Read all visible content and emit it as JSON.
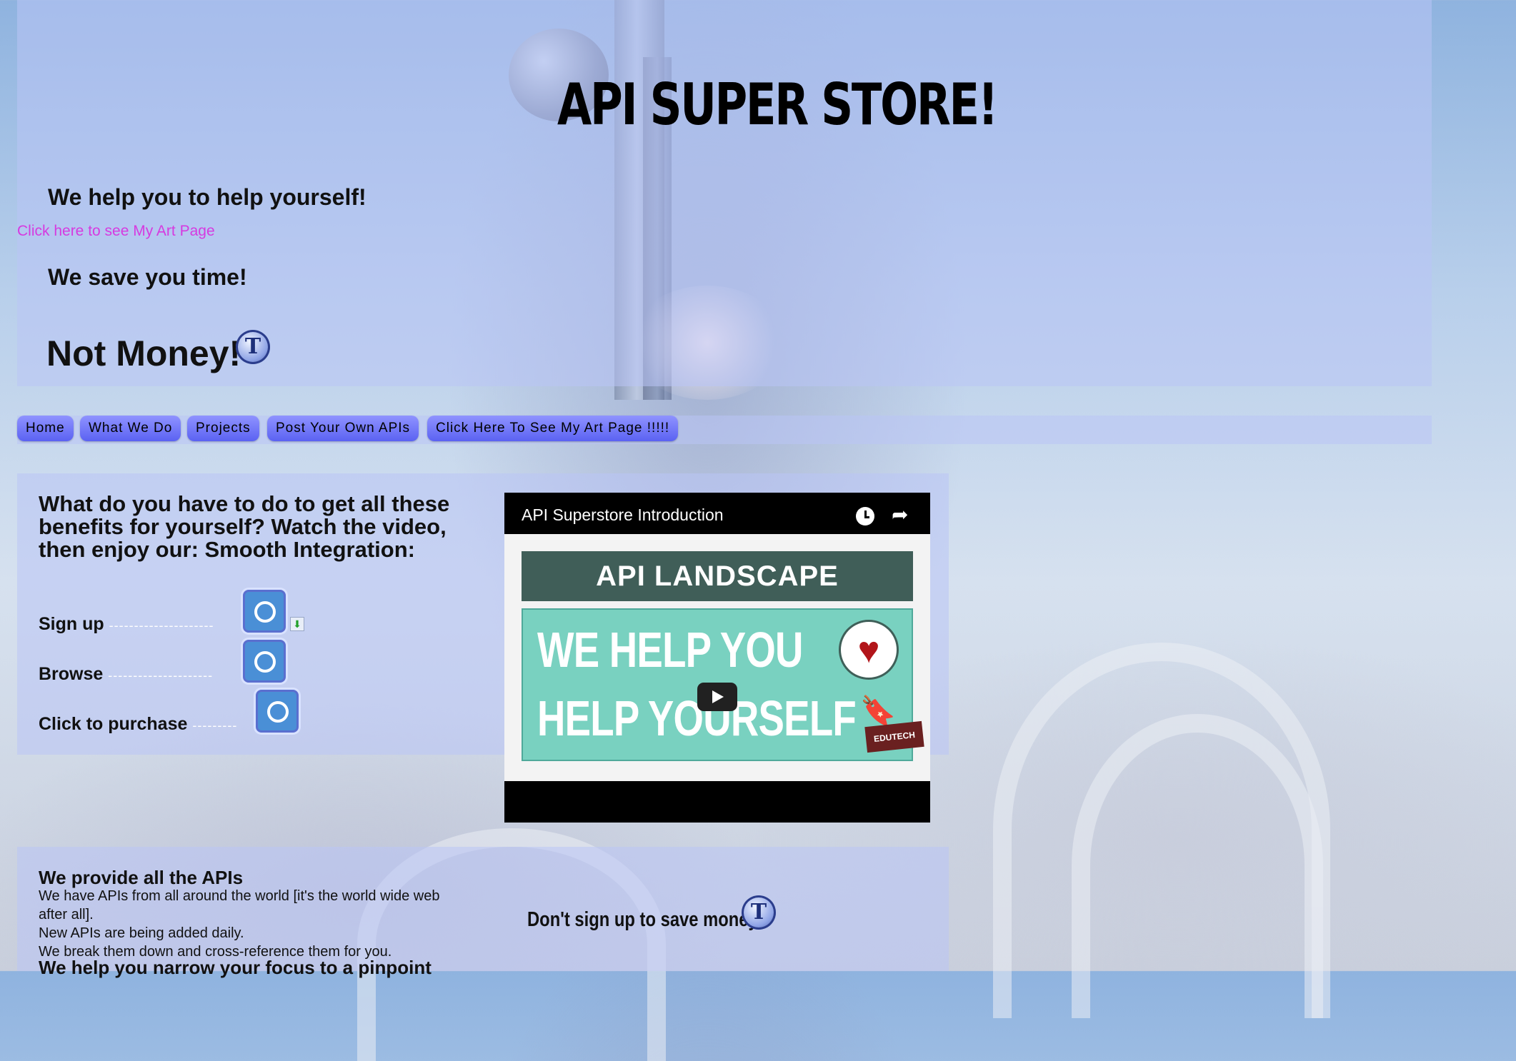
{
  "header": {
    "title": "API SUPER STORE!",
    "tagline_1": "We help you to help yourself!",
    "art_link": "Click here to see My Art Page",
    "tagline_2": "We save you time!",
    "tagline_3": "Not Money!",
    "logo_letter": "T"
  },
  "nav": {
    "items": [
      {
        "label": "Home"
      },
      {
        "label": "What We Do"
      },
      {
        "label": "Projects"
      },
      {
        "label": "Post Your Own APIs"
      },
      {
        "label": "Click Here To See My Art Page !!!!!"
      }
    ]
  },
  "intro": {
    "heading": "What do you have to do to get all these benefits for yourself? Watch the video, then enjoy our: Smooth Integration:",
    "steps": [
      {
        "label": "Sign up",
        "dashes": "---------------------"
      },
      {
        "label": "Browse",
        "dashes": "---------------------"
      },
      {
        "label": "Click to purchase",
        "dashes": "---------"
      }
    ]
  },
  "video": {
    "title": "API Superstore Introduction",
    "thumbnail_header": "API LANDSCAPE",
    "thumbnail_line_1": "WE HELP YOU",
    "thumbnail_line_2": "HELP YOURSELF",
    "badge_text": "EDUTECH"
  },
  "apis": {
    "heading": "We provide all the APIs",
    "line_1": "We have APIs from all around the world [it's the world wide web after all].",
    "line_2": "New APIs are being added daily.",
    "line_3": "We break them down and cross-reference them for you.",
    "line_4": "We help you narrow your focus to a pinpoint"
  },
  "promo": {
    "dont_signup": "Don't sign up to save money"
  },
  "colors": {
    "panel": "#bac4f6",
    "nav_button": "#6a70f5",
    "link": "#d63ae0",
    "thumbnail_teal": "#79d1c0",
    "thumbnail_header": "#405e58"
  }
}
